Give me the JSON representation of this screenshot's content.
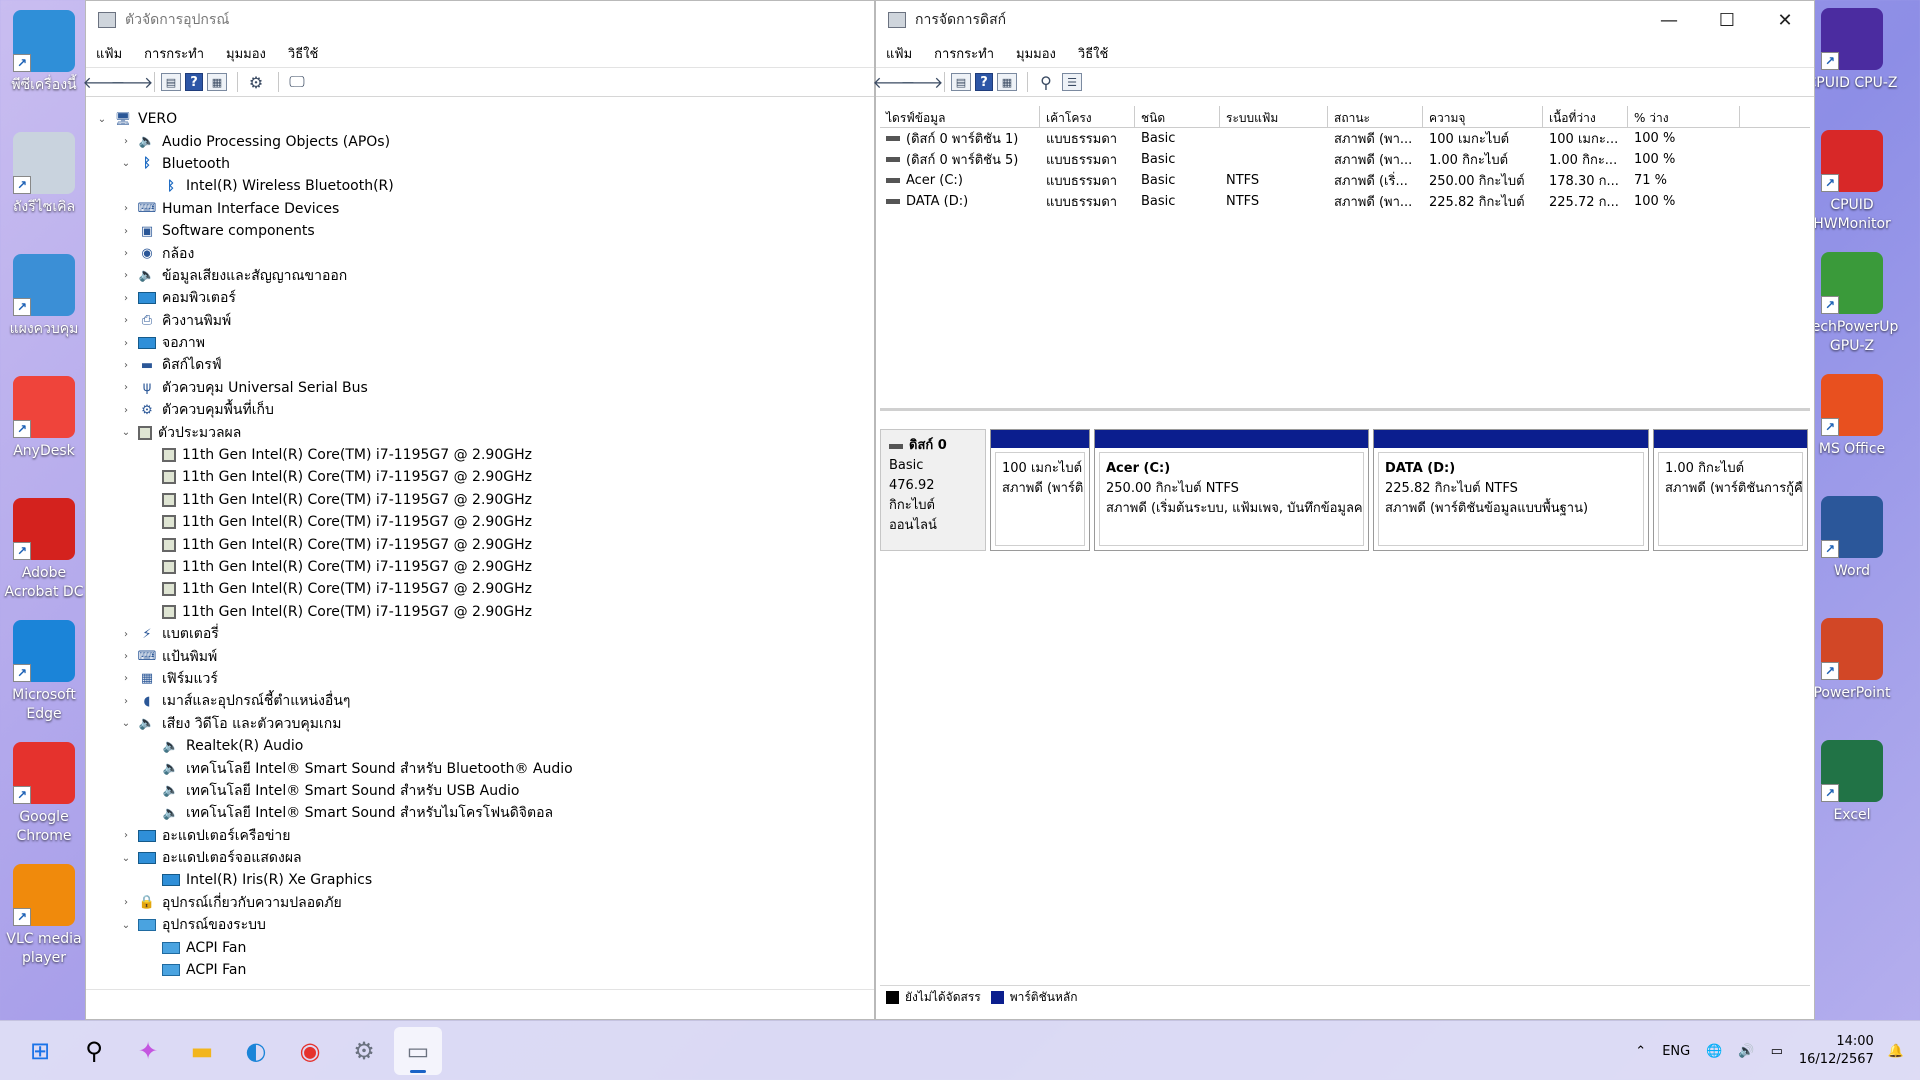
{
  "desktop_left": [
    {
      "label": "พีซีเครื่องนี้",
      "icon": "monitor-icon",
      "color": "#2f8fd8"
    },
    {
      "label": "ถังรีไซเคิล",
      "icon": "recycle-bin-icon",
      "color": "#c9d3de"
    },
    {
      "label": "แผงควบคุม",
      "icon": "control-panel-icon",
      "color": "#3b8fd6"
    },
    {
      "label": "AnyDesk",
      "icon": "anydesk-icon",
      "color": "#ef443b"
    },
    {
      "label": "Adobe Acrobat DC",
      "icon": "acrobat-icon",
      "color": "#d4221e"
    },
    {
      "label": "Microsoft Edge",
      "icon": "edge-icon",
      "color": "#1b84d8"
    },
    {
      "label": "Google Chrome",
      "icon": "chrome-icon",
      "color": "#e5322d"
    },
    {
      "label": "VLC media player",
      "icon": "vlc-icon",
      "color": "#f08a0c"
    }
  ],
  "desktop_right": [
    {
      "label": "CPUID CPU-Z",
      "icon": "cpuz-icon",
      "color": "#4b2ca0"
    },
    {
      "label": "CPUID HWMonitor",
      "icon": "hwmonitor-icon",
      "color": "#d82828"
    },
    {
      "label": "TechPowerUp GPU-Z",
      "icon": "gpuz-icon",
      "color": "#3a9a3a"
    },
    {
      "label": "MS Office",
      "icon": "office-icon",
      "color": "#e8501f"
    },
    {
      "label": "Word",
      "icon": "word-icon",
      "color": "#2b579a"
    },
    {
      "label": "PowerPoint",
      "icon": "powerpoint-icon",
      "color": "#d24726"
    },
    {
      "label": "Excel",
      "icon": "excel-icon",
      "color": "#217346"
    }
  ],
  "device_manager": {
    "title": "ตัวจัดการอุปกรณ์",
    "menu": [
      "แฟ้ม",
      "การกระทำ",
      "มุมมอง",
      "วิธีใช้"
    ],
    "tree": [
      {
        "level": 0,
        "chev": "⌄",
        "icon": "computer",
        "label": "VERO"
      },
      {
        "level": 1,
        "chev": "›",
        "icon": "spk",
        "label": "Audio Processing Objects (APOs)"
      },
      {
        "level": 1,
        "chev": "⌄",
        "icon": "bt",
        "label": "Bluetooth"
      },
      {
        "level": 2,
        "chev": "",
        "icon": "bt",
        "label": "Intel(R) Wireless Bluetooth(R)"
      },
      {
        "level": 1,
        "chev": "›",
        "icon": "hid",
        "label": "Human Interface Devices"
      },
      {
        "level": 1,
        "chev": "›",
        "icon": "sw",
        "label": "Software components"
      },
      {
        "level": 1,
        "chev": "›",
        "icon": "cam",
        "label": "กล้อง"
      },
      {
        "level": 1,
        "chev": "›",
        "icon": "spk",
        "label": "ข้อมูลเสียงและสัญญาณขาออก"
      },
      {
        "level": 1,
        "chev": "›",
        "icon": "mon",
        "label": "คอมพิวเตอร์"
      },
      {
        "level": 1,
        "chev": "›",
        "icon": "print",
        "label": "คิวงานพิมพ์"
      },
      {
        "level": 1,
        "chev": "›",
        "icon": "mon",
        "label": "จอภาพ"
      },
      {
        "level": 1,
        "chev": "›",
        "icon": "disk",
        "label": "ดิสก์ไดรฟ์"
      },
      {
        "level": 1,
        "chev": "›",
        "icon": "usb",
        "label": "ตัวควบคุม Universal Serial Bus"
      },
      {
        "level": 1,
        "chev": "›",
        "icon": "storage",
        "label": "ตัวควบคุมพื้นที่เก็บ"
      },
      {
        "level": 1,
        "chev": "⌄",
        "icon": "cpu",
        "label": "ตัวประมวลผล"
      },
      {
        "level": 2,
        "chev": "",
        "icon": "cpu",
        "label": "11th Gen Intel(R) Core(TM) i7-1195G7 @ 2.90GHz"
      },
      {
        "level": 2,
        "chev": "",
        "icon": "cpu",
        "label": "11th Gen Intel(R) Core(TM) i7-1195G7 @ 2.90GHz"
      },
      {
        "level": 2,
        "chev": "",
        "icon": "cpu",
        "label": "11th Gen Intel(R) Core(TM) i7-1195G7 @ 2.90GHz"
      },
      {
        "level": 2,
        "chev": "",
        "icon": "cpu",
        "label": "11th Gen Intel(R) Core(TM) i7-1195G7 @ 2.90GHz"
      },
      {
        "level": 2,
        "chev": "",
        "icon": "cpu",
        "label": "11th Gen Intel(R) Core(TM) i7-1195G7 @ 2.90GHz"
      },
      {
        "level": 2,
        "chev": "",
        "icon": "cpu",
        "label": "11th Gen Intel(R) Core(TM) i7-1195G7 @ 2.90GHz"
      },
      {
        "level": 2,
        "chev": "",
        "icon": "cpu",
        "label": "11th Gen Intel(R) Core(TM) i7-1195G7 @ 2.90GHz"
      },
      {
        "level": 2,
        "chev": "",
        "icon": "cpu",
        "label": "11th Gen Intel(R) Core(TM) i7-1195G7 @ 2.90GHz"
      },
      {
        "level": 1,
        "chev": "›",
        "icon": "battery",
        "label": "แบตเตอรี่"
      },
      {
        "level": 1,
        "chev": "›",
        "icon": "keyboard",
        "label": "แป้นพิมพ์"
      },
      {
        "level": 1,
        "chev": "›",
        "icon": "firmware",
        "label": "เฟิร์มแวร์"
      },
      {
        "level": 1,
        "chev": "›",
        "icon": "mouse",
        "label": "เมาส์และอุปกรณ์ชี้ตำแหน่งอื่นๆ"
      },
      {
        "level": 1,
        "chev": "⌄",
        "icon": "spk",
        "label": "เสียง วิดีโอ และตัวควบคุมเกม"
      },
      {
        "level": 2,
        "chev": "",
        "icon": "spk",
        "label": "Realtek(R) Audio"
      },
      {
        "level": 2,
        "chev": "",
        "icon": "spk",
        "label": "เทคโนโลยี Intel® Smart Sound สำหรับ Bluetooth® Audio"
      },
      {
        "level": 2,
        "chev": "",
        "icon": "spk",
        "label": "เทคโนโลยี Intel® Smart Sound สำหรับ USB Audio"
      },
      {
        "level": 2,
        "chev": "",
        "icon": "spk",
        "label": "เทคโนโลยี Intel® Smart Sound สำหรับไมโครโฟนดิจิตอล"
      },
      {
        "level": 1,
        "chev": "›",
        "icon": "mon",
        "label": "อะแดปเตอร์เครือข่าย"
      },
      {
        "level": 1,
        "chev": "⌄",
        "icon": "mon",
        "label": "อะแดปเตอร์จอแสดงผล"
      },
      {
        "level": 2,
        "chev": "",
        "icon": "mon",
        "label": "Intel(R) Iris(R) Xe Graphics"
      },
      {
        "level": 1,
        "chev": "›",
        "icon": "security",
        "label": "อุปกรณ์เกี่ยวกับความปลอดภัย"
      },
      {
        "level": 1,
        "chev": "⌄",
        "icon": "fan",
        "label": "อุปกรณ์ของระบบ"
      },
      {
        "level": 2,
        "chev": "",
        "icon": "fan",
        "label": "ACPI Fan"
      },
      {
        "level": 2,
        "chev": "",
        "icon": "fan",
        "label": "ACPI Fan"
      }
    ]
  },
  "disk_management": {
    "title": "การจัดการดิสก์",
    "menu": [
      "แฟ้ม",
      "การกระทำ",
      "มุมมอง",
      "วิธีใช้"
    ],
    "columns": [
      "ไดรฟ์ข้อมูล",
      "เค้าโครง",
      "ชนิด",
      "ระบบแฟ้ม",
      "สถานะ",
      "ความจุ",
      "เนื้อที่ว่าง",
      "% ว่าง"
    ],
    "volumes": [
      [
        "(ดิสก์ 0 พาร์ติชัน 1)",
        "แบบธรรมดา",
        "Basic",
        "",
        "สภาพดี (พา...",
        "100 เมกะไบต์",
        "100 เมกะ...",
        "100 %"
      ],
      [
        "(ดิสก์ 0 พาร์ติชัน 5)",
        "แบบธรรมดา",
        "Basic",
        "",
        "สภาพดี (พา...",
        "1.00 กิกะไบต์",
        "1.00 กิกะ...",
        "100 %"
      ],
      [
        "Acer (C:)",
        "แบบธรรมดา",
        "Basic",
        "NTFS",
        "สภาพดี (เริ่...",
        "250.00 กิกะไบต์",
        "178.30 ก...",
        "71 %"
      ],
      [
        "DATA (D:)",
        "แบบธรรมดา",
        "Basic",
        "NTFS",
        "สภาพดี (พา...",
        "225.82 กิกะไบต์",
        "225.72 ก...",
        "100 %"
      ]
    ],
    "disk": {
      "name": "ดิสก์ 0",
      "type": "Basic",
      "size": "476.92 กิกะไบต์",
      "state": "ออนไลน์"
    },
    "partitions": [
      {
        "name": "",
        "size": "100 เมกะไบต์",
        "status": "สภาพดี (พาร์ติชัน EFI)"
      },
      {
        "name": "Acer  (C:)",
        "size": "250.00 กิกะไบต์ NTFS",
        "status": "สภาพดี (เริ่มต้นระบบ, แฟ้มเพจ, บันทึกข้อมูลความผิดพลาด)"
      },
      {
        "name": "DATA  (D:)",
        "size": "225.82 กิกะไบต์ NTFS",
        "status": "สภาพดี (พาร์ติชันข้อมูลแบบพื้นฐาน)"
      },
      {
        "name": "",
        "size": "1.00 กิกะไบต์",
        "status": "สภาพดี (พาร์ติชันการกู้คืน)"
      }
    ],
    "legend": [
      {
        "label": "ยังไม่ได้จัดสรร",
        "color": "#000000"
      },
      {
        "label": "พาร์ติชันหลัก",
        "color": "#0b1e8e"
      }
    ]
  },
  "taskbar": {
    "language": "ENG",
    "time": "14:00",
    "date": "16/12/2567"
  }
}
